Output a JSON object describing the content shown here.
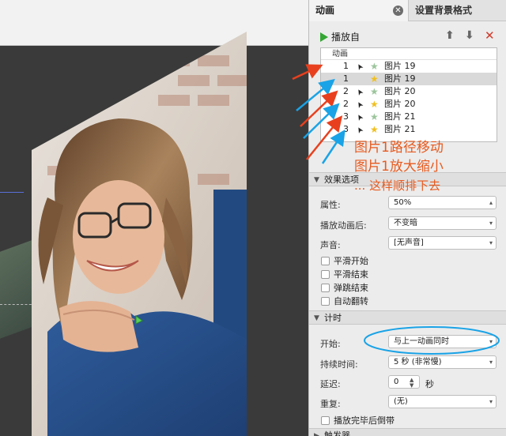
{
  "tabs": {
    "animation": "动画",
    "background": "设置背景格式"
  },
  "toolbar": {
    "play_label": "播放自"
  },
  "anim_list": {
    "header": "动画",
    "rows": [
      {
        "num": "1",
        "label": "图片 19",
        "type": "path",
        "selected": false
      },
      {
        "num": "1",
        "label": "图片 19",
        "type": "zoom",
        "selected": true
      },
      {
        "num": "2",
        "label": "图片 20",
        "type": "path",
        "selected": false
      },
      {
        "num": "2",
        "label": "图片 20",
        "type": "zoom",
        "selected": false
      },
      {
        "num": "3",
        "label": "图片 21",
        "type": "path",
        "selected": false
      },
      {
        "num": "3",
        "label": "图片 21",
        "type": "zoom",
        "selected": false
      }
    ]
  },
  "effects": {
    "title": "效果选项",
    "property_label": "属性:",
    "property_value": "50%",
    "after_label": "播放动画后:",
    "after_value": "不变暗",
    "sound_label": "声音:",
    "sound_value": "[无声音]",
    "checks": [
      "平滑开始",
      "平滑结束",
      "弹跳结束",
      "自动翻转"
    ]
  },
  "timing": {
    "title": "计时",
    "start_label": "开始:",
    "start_value": "与上一动画同时",
    "duration_label": "持续时间:",
    "duration_value": "5 秒 (非常慢)",
    "delay_label": "延迟:",
    "delay_value": "0",
    "delay_unit": "秒",
    "repeat_label": "重复:",
    "repeat_value": "(无)",
    "rewind_label": "播放完毕后倒带"
  },
  "triggers": {
    "title": "触发器"
  },
  "annotation": {
    "line1": "图片1路径移动",
    "line2": "图片1放大缩小",
    "line3": "... 这样顺排下去",
    "color": "#e85a1e"
  }
}
